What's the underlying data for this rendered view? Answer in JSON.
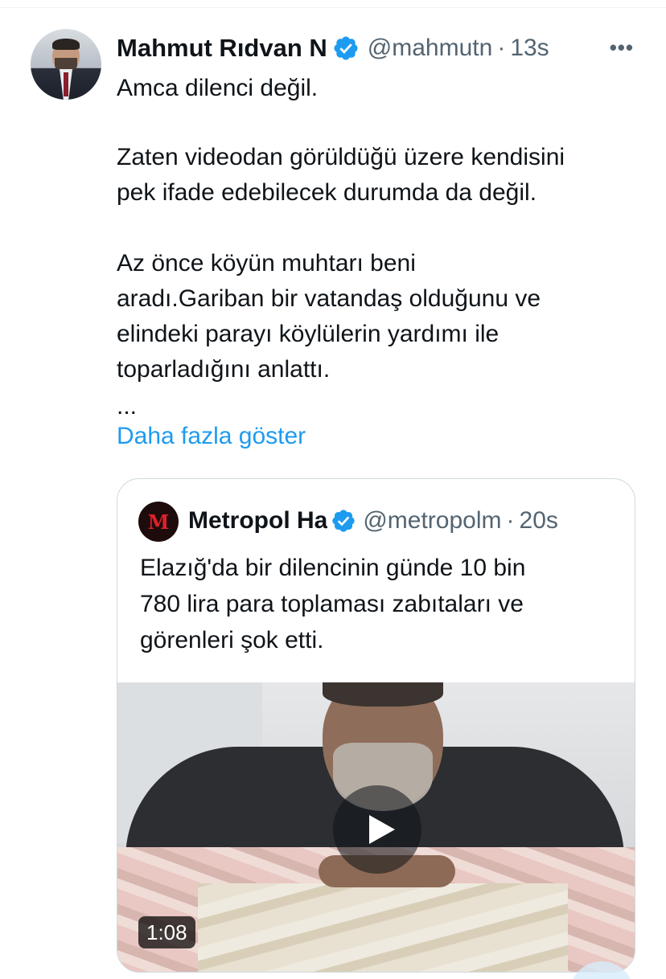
{
  "tweet": {
    "author_name": "Mahmut Rıdvan N",
    "handle": "@mahmutn",
    "separator": "·",
    "time": "13s",
    "more_icon": "more-icon",
    "text_lines": [
      "Amca dilenci değil.",
      "Zaten videodan görüldüğü üzere kendisini",
      "pek ifade edebilecek durumda da değil.",
      "Az önce köyün muhtarı beni",
      "aradı.Gariban bir vatandaş olduğunu ve",
      "elindeki parayı köylülerin yardımı ile",
      "toparladığını anlattı.",
      "..."
    ],
    "show_more": "Daha fazla göster"
  },
  "quote": {
    "avatar_letter": "M",
    "author_name": "Metropol Ha",
    "handle": "@metropolm",
    "separator": "·",
    "time": "20s",
    "text_lines": [
      "Elazığ'da bir dilencinin günde 10 bin",
      "780 lira para toplaması zabıtaları ve",
      "görenleri şok etti."
    ],
    "video_duration": "1:08"
  },
  "colors": {
    "text": "#0f1419",
    "secondary": "#536471",
    "link": "#1d9bf0",
    "verified": "#1d9bf0",
    "border": "#cfd9de"
  }
}
